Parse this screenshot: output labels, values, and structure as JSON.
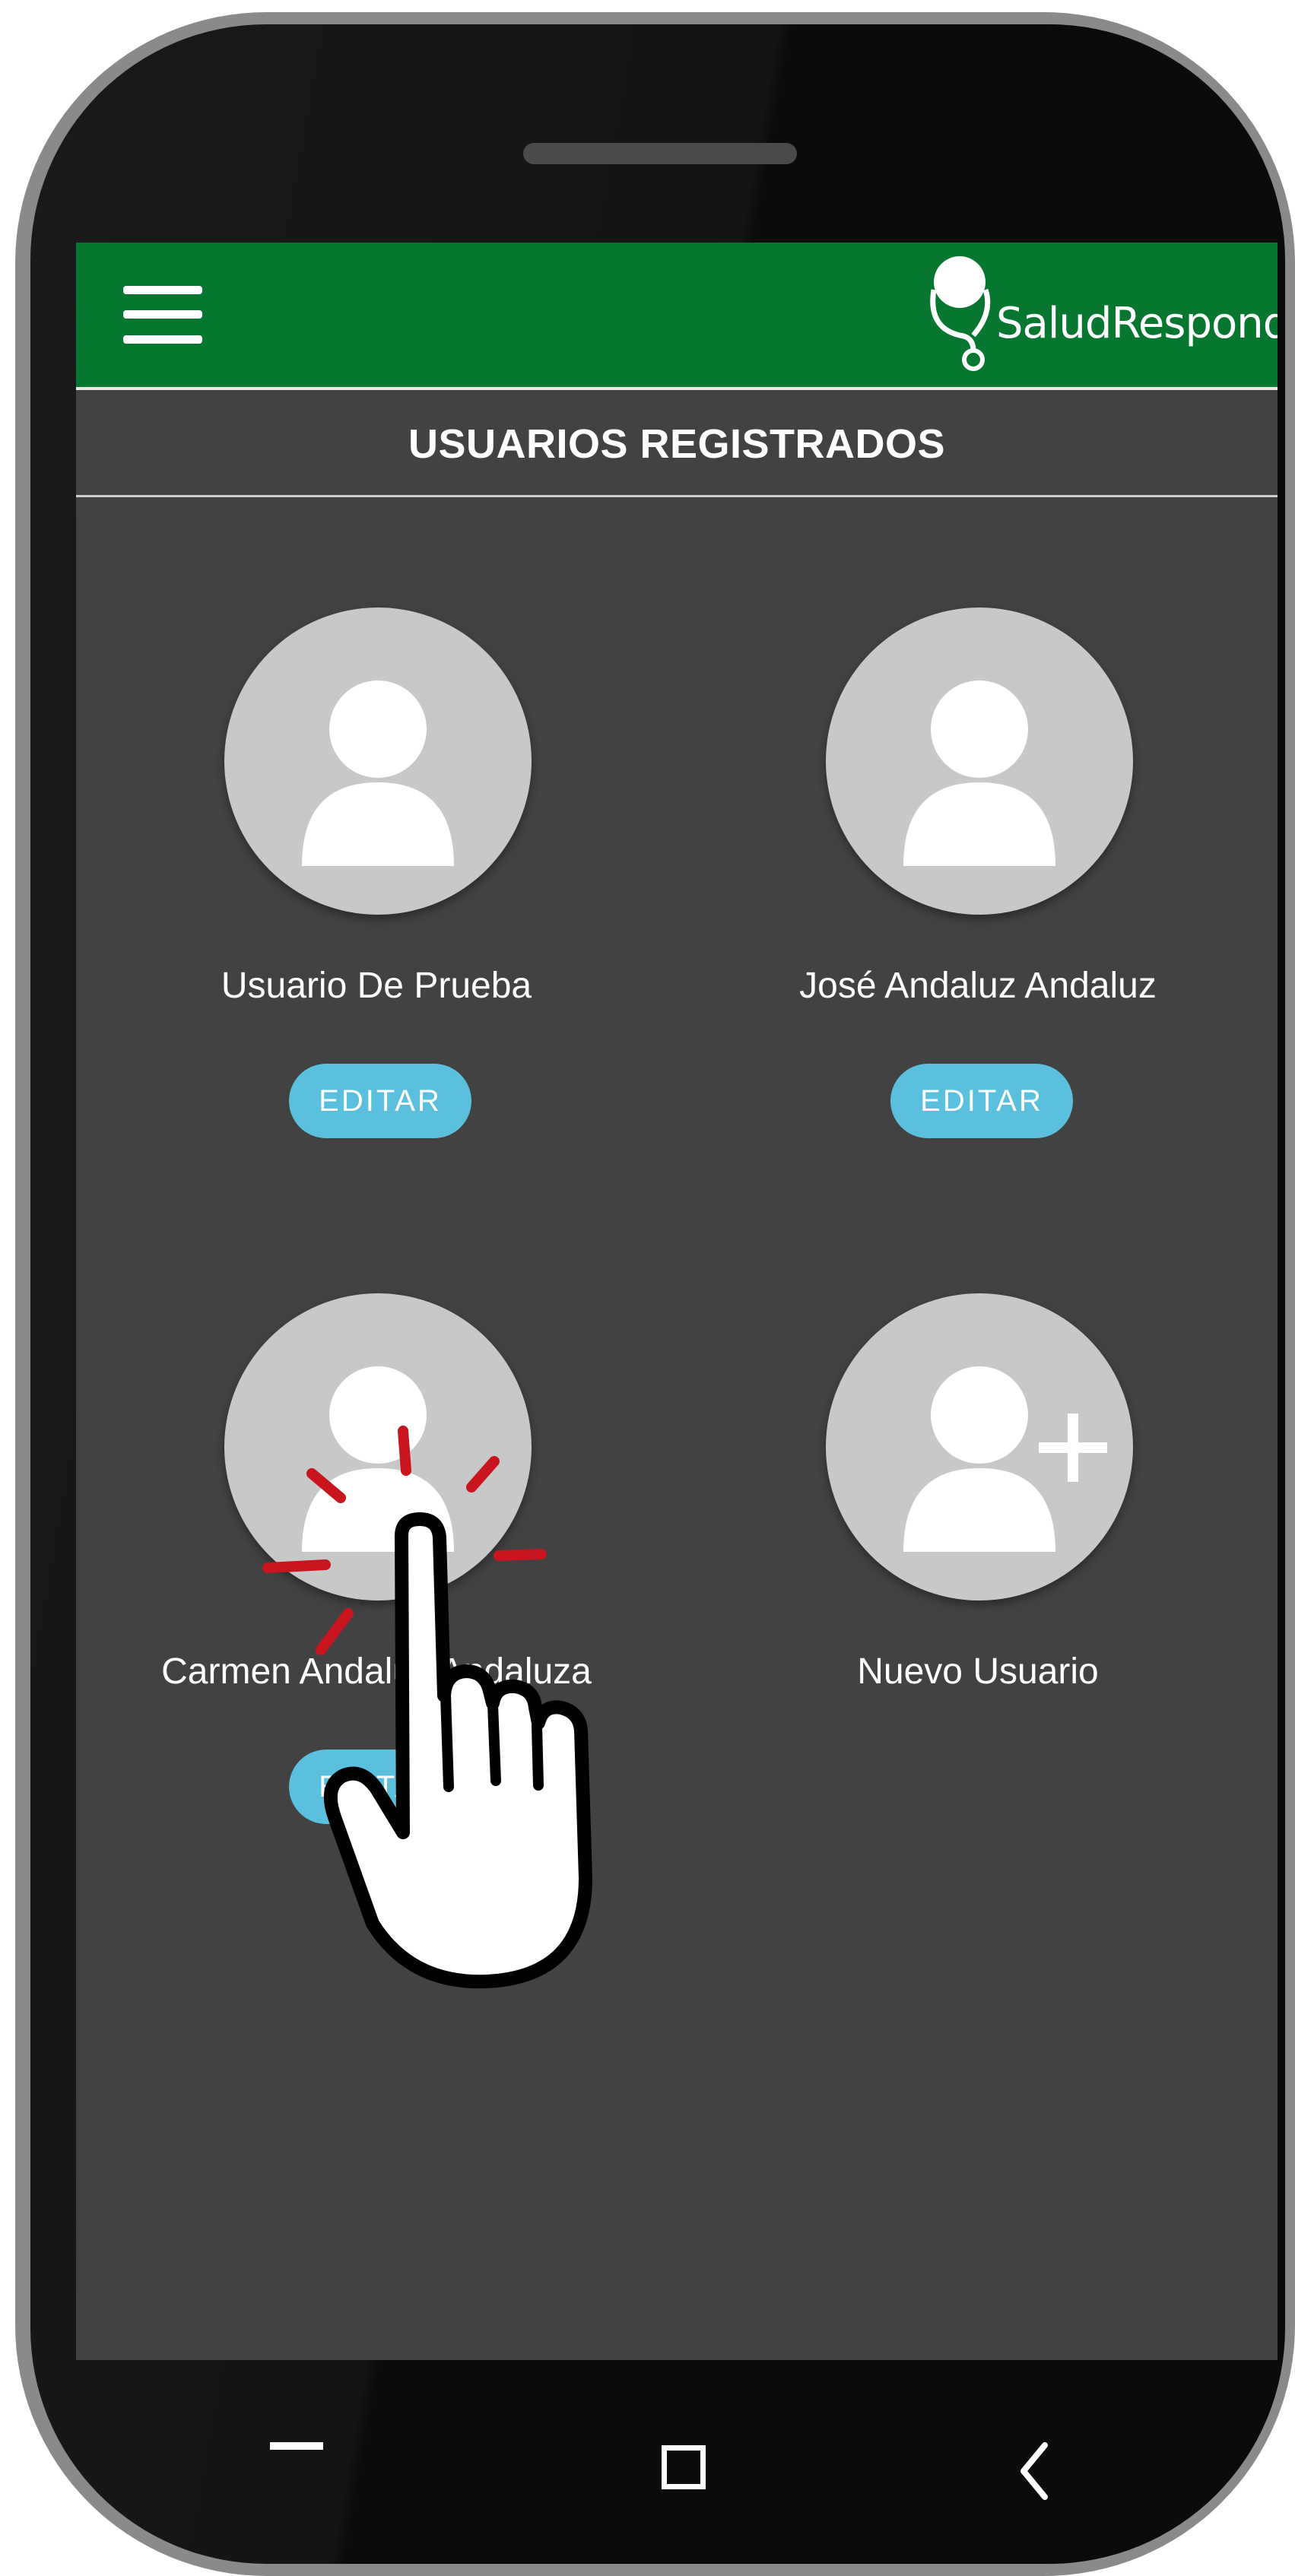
{
  "app": {
    "brand_name": "SaludResponde",
    "brand_color": "#07762e",
    "accent_color": "#5bc0de"
  },
  "header": {
    "menu_icon": "hamburger-menu-icon",
    "logo_icon": "stethoscope-logo-icon"
  },
  "page": {
    "title": "USUARIOS REGISTRADOS"
  },
  "users": [
    {
      "name": "Usuario De Prueba",
      "edit_label": "EDITAR",
      "avatar_icon": "person-avatar-icon"
    },
    {
      "name": "José Andaluz Andaluz",
      "edit_label": "EDITAR",
      "avatar_icon": "person-avatar-icon"
    },
    {
      "name": "Carmen Andaluz Andaluza",
      "edit_label": "EDITAR",
      "avatar_icon": "person-avatar-icon"
    }
  ],
  "new_user": {
    "name": "Nuevo Usuario",
    "avatar_icon": "add-person-icon"
  },
  "system_nav": {
    "recents_icon": "recents-dash-icon",
    "home_icon": "home-square-icon",
    "back_icon": "back-chevron-icon"
  },
  "overlay": {
    "gesture_icon": "tap-hand-icon"
  }
}
